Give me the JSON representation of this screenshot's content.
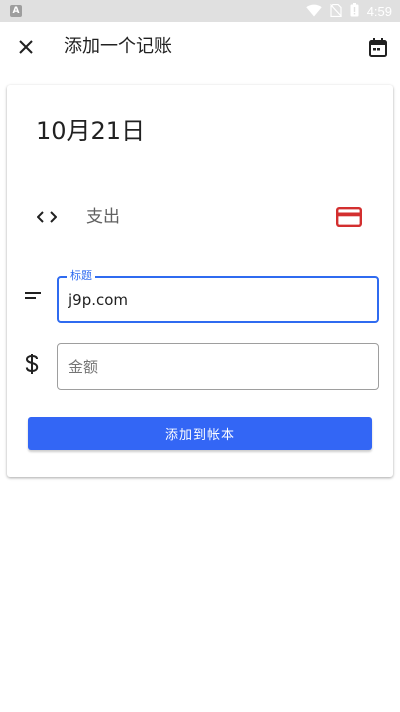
{
  "status_bar": {
    "notification_icon": "A",
    "time": "4:59",
    "icons": [
      "wifi-icon",
      "no-sim-icon",
      "battery-icon"
    ]
  },
  "app_bar": {
    "title": "添加一个记账",
    "close_icon": "close-icon",
    "calendar_icon": "calendar-icon"
  },
  "form": {
    "date": "10月21日",
    "type_label": "支出",
    "title_field": {
      "label": "标题",
      "value": "j9p.com"
    },
    "amount_field": {
      "placeholder": "金额",
      "value": ""
    },
    "submit_label": "添加到帐本"
  },
  "colors": {
    "accent": "#3366f5",
    "focus_border": "#2f6bf0",
    "expense_icon": "#d32f2f"
  }
}
